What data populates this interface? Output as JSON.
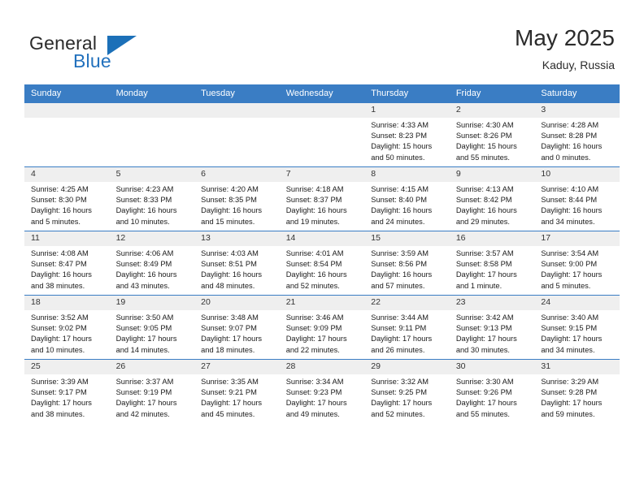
{
  "brand": {
    "name_part1": "General",
    "name_part2": "Blue",
    "logo_icon": "flag-triangle-icon",
    "accent_color": "#2271bd"
  },
  "header": {
    "title": "May 2025",
    "subtitle": "Kaduy, Russia"
  },
  "theme": {
    "header_row_bg": "#3a7dc4",
    "shaded_cell_bg": "#efefef",
    "text_color": "#1a1a1a"
  },
  "calendar": {
    "weekday_headers": [
      "Sunday",
      "Monday",
      "Tuesday",
      "Wednesday",
      "Thursday",
      "Friday",
      "Saturday"
    ],
    "weeks": [
      [
        {
          "day": "",
          "empty": true,
          "shaded": true,
          "sunrise": "",
          "sunset": "",
          "daylight1": "",
          "daylight2": ""
        },
        {
          "day": "",
          "empty": true,
          "shaded": true,
          "sunrise": "",
          "sunset": "",
          "daylight1": "",
          "daylight2": ""
        },
        {
          "day": "",
          "empty": true,
          "shaded": true,
          "sunrise": "",
          "sunset": "",
          "daylight1": "",
          "daylight2": ""
        },
        {
          "day": "",
          "empty": true,
          "shaded": true,
          "sunrise": "",
          "sunset": "",
          "daylight1": "",
          "daylight2": ""
        },
        {
          "day": "1",
          "shaded": true,
          "sunrise": "Sunrise: 4:33 AM",
          "sunset": "Sunset: 8:23 PM",
          "daylight1": "Daylight: 15 hours",
          "daylight2": "and 50 minutes."
        },
        {
          "day": "2",
          "shaded": true,
          "sunrise": "Sunrise: 4:30 AM",
          "sunset": "Sunset: 8:26 PM",
          "daylight1": "Daylight: 15 hours",
          "daylight2": "and 55 minutes."
        },
        {
          "day": "3",
          "shaded": true,
          "sunrise": "Sunrise: 4:28 AM",
          "sunset": "Sunset: 8:28 PM",
          "daylight1": "Daylight: 16 hours",
          "daylight2": "and 0 minutes."
        }
      ],
      [
        {
          "day": "4",
          "shaded": true,
          "sunrise": "Sunrise: 4:25 AM",
          "sunset": "Sunset: 8:30 PM",
          "daylight1": "Daylight: 16 hours",
          "daylight2": "and 5 minutes."
        },
        {
          "day": "5",
          "shaded": true,
          "sunrise": "Sunrise: 4:23 AM",
          "sunset": "Sunset: 8:33 PM",
          "daylight1": "Daylight: 16 hours",
          "daylight2": "and 10 minutes."
        },
        {
          "day": "6",
          "shaded": true,
          "sunrise": "Sunrise: 4:20 AM",
          "sunset": "Sunset: 8:35 PM",
          "daylight1": "Daylight: 16 hours",
          "daylight2": "and 15 minutes."
        },
        {
          "day": "7",
          "shaded": true,
          "sunrise": "Sunrise: 4:18 AM",
          "sunset": "Sunset: 8:37 PM",
          "daylight1": "Daylight: 16 hours",
          "daylight2": "and 19 minutes."
        },
        {
          "day": "8",
          "shaded": true,
          "sunrise": "Sunrise: 4:15 AM",
          "sunset": "Sunset: 8:40 PM",
          "daylight1": "Daylight: 16 hours",
          "daylight2": "and 24 minutes."
        },
        {
          "day": "9",
          "shaded": true,
          "sunrise": "Sunrise: 4:13 AM",
          "sunset": "Sunset: 8:42 PM",
          "daylight1": "Daylight: 16 hours",
          "daylight2": "and 29 minutes."
        },
        {
          "day": "10",
          "shaded": true,
          "sunrise": "Sunrise: 4:10 AM",
          "sunset": "Sunset: 8:44 PM",
          "daylight1": "Daylight: 16 hours",
          "daylight2": "and 34 minutes."
        }
      ],
      [
        {
          "day": "11",
          "shaded": true,
          "sunrise": "Sunrise: 4:08 AM",
          "sunset": "Sunset: 8:47 PM",
          "daylight1": "Daylight: 16 hours",
          "daylight2": "and 38 minutes."
        },
        {
          "day": "12",
          "shaded": true,
          "sunrise": "Sunrise: 4:06 AM",
          "sunset": "Sunset: 8:49 PM",
          "daylight1": "Daylight: 16 hours",
          "daylight2": "and 43 minutes."
        },
        {
          "day": "13",
          "shaded": true,
          "sunrise": "Sunrise: 4:03 AM",
          "sunset": "Sunset: 8:51 PM",
          "daylight1": "Daylight: 16 hours",
          "daylight2": "and 48 minutes."
        },
        {
          "day": "14",
          "shaded": true,
          "sunrise": "Sunrise: 4:01 AM",
          "sunset": "Sunset: 8:54 PM",
          "daylight1": "Daylight: 16 hours",
          "daylight2": "and 52 minutes."
        },
        {
          "day": "15",
          "shaded": true,
          "sunrise": "Sunrise: 3:59 AM",
          "sunset": "Sunset: 8:56 PM",
          "daylight1": "Daylight: 16 hours",
          "daylight2": "and 57 minutes."
        },
        {
          "day": "16",
          "shaded": true,
          "sunrise": "Sunrise: 3:57 AM",
          "sunset": "Sunset: 8:58 PM",
          "daylight1": "Daylight: 17 hours",
          "daylight2": "and 1 minute."
        },
        {
          "day": "17",
          "shaded": true,
          "sunrise": "Sunrise: 3:54 AM",
          "sunset": "Sunset: 9:00 PM",
          "daylight1": "Daylight: 17 hours",
          "daylight2": "and 5 minutes."
        }
      ],
      [
        {
          "day": "18",
          "shaded": true,
          "sunrise": "Sunrise: 3:52 AM",
          "sunset": "Sunset: 9:02 PM",
          "daylight1": "Daylight: 17 hours",
          "daylight2": "and 10 minutes."
        },
        {
          "day": "19",
          "shaded": true,
          "sunrise": "Sunrise: 3:50 AM",
          "sunset": "Sunset: 9:05 PM",
          "daylight1": "Daylight: 17 hours",
          "daylight2": "and 14 minutes."
        },
        {
          "day": "20",
          "shaded": true,
          "sunrise": "Sunrise: 3:48 AM",
          "sunset": "Sunset: 9:07 PM",
          "daylight1": "Daylight: 17 hours",
          "daylight2": "and 18 minutes."
        },
        {
          "day": "21",
          "shaded": true,
          "sunrise": "Sunrise: 3:46 AM",
          "sunset": "Sunset: 9:09 PM",
          "daylight1": "Daylight: 17 hours",
          "daylight2": "and 22 minutes."
        },
        {
          "day": "22",
          "shaded": true,
          "sunrise": "Sunrise: 3:44 AM",
          "sunset": "Sunset: 9:11 PM",
          "daylight1": "Daylight: 17 hours",
          "daylight2": "and 26 minutes."
        },
        {
          "day": "23",
          "shaded": true,
          "sunrise": "Sunrise: 3:42 AM",
          "sunset": "Sunset: 9:13 PM",
          "daylight1": "Daylight: 17 hours",
          "daylight2": "and 30 minutes."
        },
        {
          "day": "24",
          "shaded": true,
          "sunrise": "Sunrise: 3:40 AM",
          "sunset": "Sunset: 9:15 PM",
          "daylight1": "Daylight: 17 hours",
          "daylight2": "and 34 minutes."
        }
      ],
      [
        {
          "day": "25",
          "shaded": true,
          "sunrise": "Sunrise: 3:39 AM",
          "sunset": "Sunset: 9:17 PM",
          "daylight1": "Daylight: 17 hours",
          "daylight2": "and 38 minutes."
        },
        {
          "day": "26",
          "shaded": true,
          "sunrise": "Sunrise: 3:37 AM",
          "sunset": "Sunset: 9:19 PM",
          "daylight1": "Daylight: 17 hours",
          "daylight2": "and 42 minutes."
        },
        {
          "day": "27",
          "shaded": true,
          "sunrise": "Sunrise: 3:35 AM",
          "sunset": "Sunset: 9:21 PM",
          "daylight1": "Daylight: 17 hours",
          "daylight2": "and 45 minutes."
        },
        {
          "day": "28",
          "shaded": true,
          "sunrise": "Sunrise: 3:34 AM",
          "sunset": "Sunset: 9:23 PM",
          "daylight1": "Daylight: 17 hours",
          "daylight2": "and 49 minutes."
        },
        {
          "day": "29",
          "shaded": true,
          "sunrise": "Sunrise: 3:32 AM",
          "sunset": "Sunset: 9:25 PM",
          "daylight1": "Daylight: 17 hours",
          "daylight2": "and 52 minutes."
        },
        {
          "day": "30",
          "shaded": true,
          "sunrise": "Sunrise: 3:30 AM",
          "sunset": "Sunset: 9:26 PM",
          "daylight1": "Daylight: 17 hours",
          "daylight2": "and 55 minutes."
        },
        {
          "day": "31",
          "shaded": true,
          "sunrise": "Sunrise: 3:29 AM",
          "sunset": "Sunset: 9:28 PM",
          "daylight1": "Daylight: 17 hours",
          "daylight2": "and 59 minutes."
        }
      ]
    ]
  }
}
